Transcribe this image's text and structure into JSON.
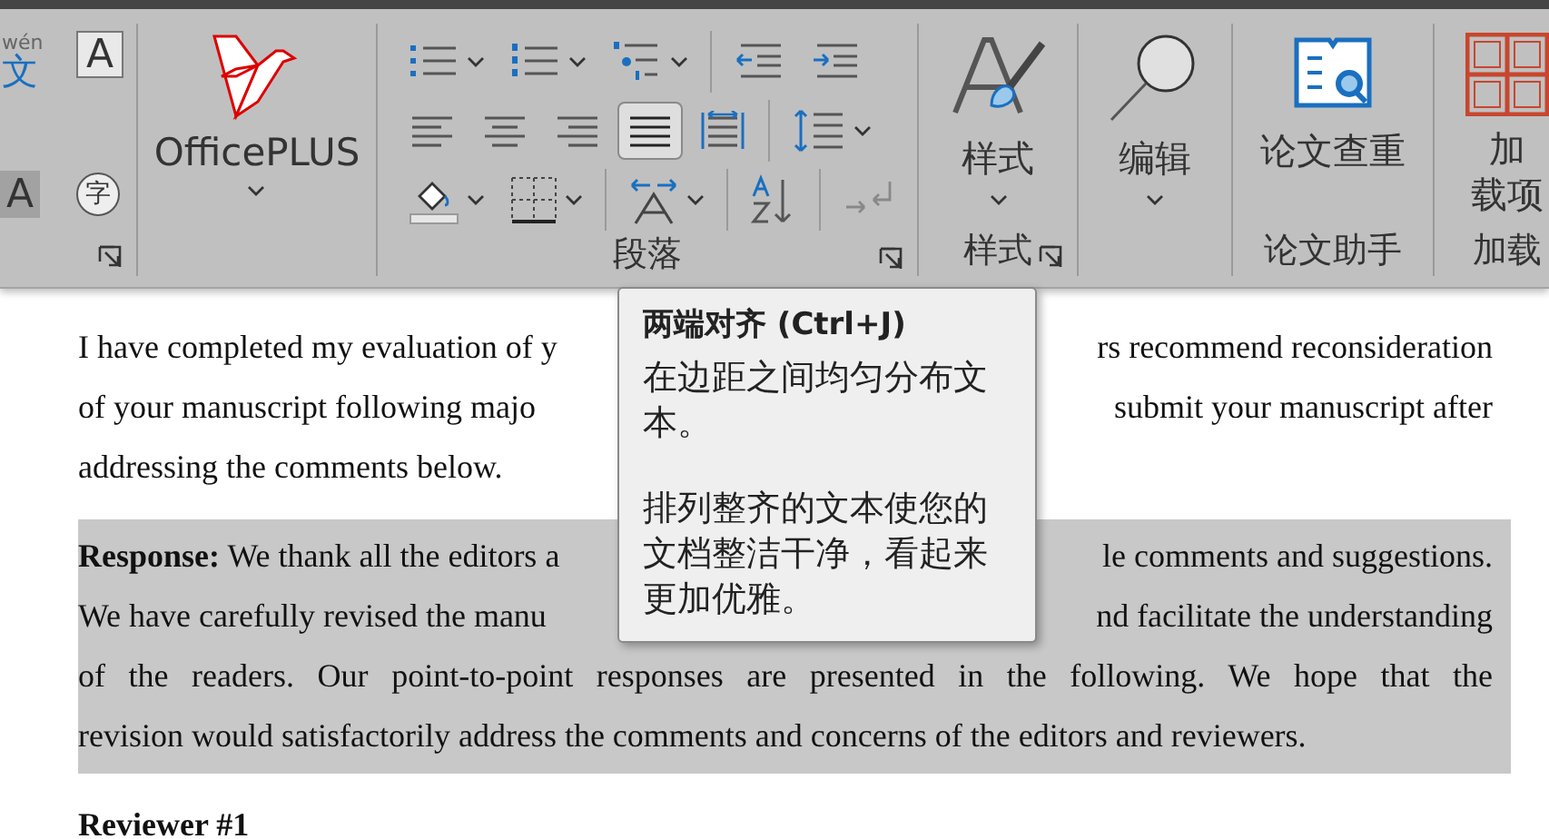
{
  "ribbon": {
    "font_group": {
      "buttons": [
        {
          "kind": "phonetic",
          "ruby": "wén",
          "glyph": "文"
        },
        {
          "kind": "border",
          "glyph": "A"
        },
        {
          "kind": "shading",
          "glyph": "A"
        },
        {
          "kind": "enclose",
          "glyph": "字"
        }
      ]
    },
    "officeplus": {
      "label": "OfficePLUS"
    },
    "paragraph": {
      "label": "段落",
      "alignment": [
        {
          "kind": "left",
          "selected": false
        },
        {
          "kind": "center",
          "selected": false
        },
        {
          "kind": "right",
          "selected": false
        },
        {
          "kind": "justify",
          "selected": true
        },
        {
          "kind": "distributed",
          "selected": false
        }
      ]
    },
    "styles": {
      "button": "样式",
      "label": "样式"
    },
    "editing": {
      "button": "编辑"
    },
    "thesis": {
      "button": "论文查重",
      "label": "论文助手"
    },
    "addins": {
      "button_lines": [
        "加",
        "载项"
      ],
      "label": "加载"
    }
  },
  "tooltip": {
    "title": "两端对齐 (Ctrl+J)",
    "paragraphs": [
      "在边距之间均匀分布文本。",
      "排列整齐的文本使您的文档整洁干净，看起来更加优雅。"
    ]
  },
  "document": {
    "paragraphs": [
      {
        "kind": "body",
        "selected": false,
        "lines": [
          {
            "left": "I have completed my evaluation of y",
            "right": "rs recommend reconsideration"
          },
          {
            "left": "of your manuscript following majo",
            "right": "submit your manuscript after"
          },
          {
            "text": "addressing the comments below."
          }
        ]
      },
      {
        "kind": "body",
        "selected": true,
        "lines": [
          {
            "left": "**Response:** We thank all the editors a",
            "right": "le comments and suggestions."
          },
          {
            "left": "We have carefully revised the manu",
            "right": "nd facilitate the understanding"
          },
          {
            "text": "of the readers. Our point-to-point responses are presented in the following. We hope that the"
          },
          {
            "text": "revision would satisfactorily address the comments and concerns of the editors and reviewers."
          }
        ]
      },
      {
        "kind": "heading",
        "selected": false,
        "lines": [
          {
            "text": "Reviewer #1"
          }
        ]
      }
    ]
  }
}
